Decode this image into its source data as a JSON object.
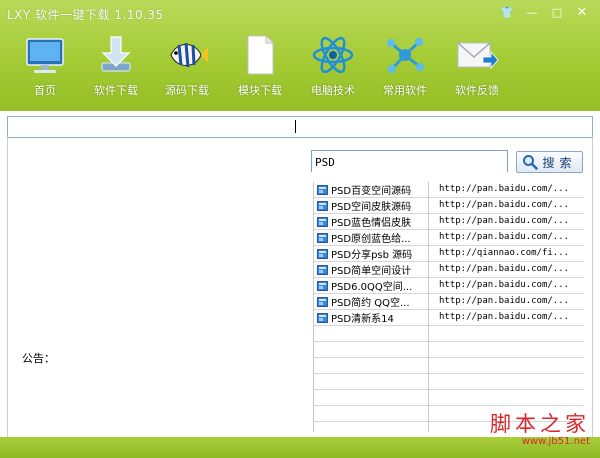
{
  "window": {
    "title": "LXY 软件一键下载 1.10.35",
    "controls": {
      "skin": "👕",
      "minimize": "—",
      "maximize": "□",
      "close": "✕"
    }
  },
  "toolbar": {
    "items": [
      {
        "label": "首页",
        "icon": "monitor-icon"
      },
      {
        "label": "软件下载",
        "icon": "download-arrow-icon"
      },
      {
        "label": "源码下载",
        "icon": "fish-icon"
      },
      {
        "label": "模块下载",
        "icon": "document-icon"
      },
      {
        "label": "电脑技术",
        "icon": "atom-icon"
      },
      {
        "label": "常用软件",
        "icon": "molecule-icon"
      },
      {
        "label": "软件反馈",
        "icon": "mail-icon"
      }
    ]
  },
  "address": {
    "value": ""
  },
  "notice": {
    "label": "公告："
  },
  "search": {
    "value": "PSD",
    "button_label": "搜索"
  },
  "results": [
    {
      "name": "PSD百变空间源码",
      "url": "http://pan.baidu.com/..."
    },
    {
      "name": "PSD空间皮肤源码",
      "url": "http://pan.baidu.com/..."
    },
    {
      "name": "PSD蓝色情侣皮肤",
      "url": "http://pan.baidu.com/..."
    },
    {
      "name": "PSD原创蓝色给...",
      "url": "http://pan.baidu.com/..."
    },
    {
      "name": "PSD分享psb 源码",
      "url": "http://qiannao.com/fi..."
    },
    {
      "name": "PSD简单空间设计",
      "url": "http://pan.baidu.com/..."
    },
    {
      "name": "PSD6.0QQ空间...",
      "url": "http://pan.baidu.com/..."
    },
    {
      "name": "PSD简约 QQ空...",
      "url": "http://pan.baidu.com/..."
    },
    {
      "name": "PSD清新系14",
      "url": "http://pan.baidu.com/..."
    },
    {
      "name": "",
      "url": ""
    },
    {
      "name": "",
      "url": ""
    },
    {
      "name": "",
      "url": ""
    },
    {
      "name": "",
      "url": ""
    },
    {
      "name": "",
      "url": ""
    },
    {
      "name": "",
      "url": ""
    }
  ],
  "watermark": {
    "line1": "脚本之家",
    "line2": "www.jb51.net"
  },
  "colors": {
    "header_green": "#a4cb35",
    "border_blue": "#8ab0d8",
    "watermark_red": "#d9262a"
  }
}
